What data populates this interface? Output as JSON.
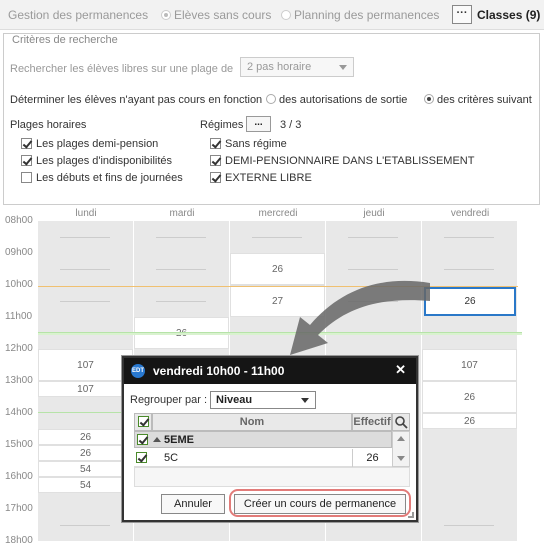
{
  "topbar": {
    "gestion": "Gestion des permanences",
    "eleves": "Elèves sans cours",
    "planning": "Planning des permanences",
    "more_label": "···",
    "classes": "Classes (9)"
  },
  "criteria": {
    "legend": "Critères de recherche",
    "search_label": "Rechercher les élèves libres sur une plage de",
    "plage_value": "2 pas horaire",
    "determine_label": "Déterminer les élèves n'ayant pas cours en fonction",
    "opt_autorisations": "des autorisations de sortie",
    "opt_criteres": "des critères suivant",
    "plages_label": "Plages horaires",
    "plages": [
      {
        "label": "Les plages demi-pension",
        "checked": true
      },
      {
        "label": "Les plages d'indisponibilités",
        "checked": true
      },
      {
        "label": "Les débuts et fins de journées",
        "checked": false
      }
    ],
    "regimes_label": "Régimes",
    "regimes_btn": "...",
    "regimes_count": "3 / 3",
    "regimes": [
      {
        "label": "Sans régime",
        "checked": true
      },
      {
        "label": "DEMI-PENSIONNAIRE DANS L'ETABLISSEMENT",
        "checked": true
      },
      {
        "label": "EXTERNE LIBRE",
        "checked": true
      }
    ]
  },
  "schedule": {
    "days": [
      "lundi",
      "mardi",
      "mercredi",
      "jeudi",
      "vendredi"
    ],
    "hours": [
      "08h00",
      "09h00",
      "10h00",
      "11h00",
      "12h00",
      "13h00",
      "14h00",
      "15h00",
      "16h00",
      "17h00",
      "18h00"
    ],
    "values": {
      "mer_09": "26",
      "mer_10": "27",
      "ven_10": "26",
      "mar_11": "26",
      "lun_12": "107",
      "ven_12": "107",
      "lun_13": "107",
      "ven_13": "26",
      "ven_14": "26",
      "lun_1430": "26",
      "lun_15": "26",
      "lun_1530": "54",
      "lun_16": "54"
    }
  },
  "popup": {
    "title": "vendredi 10h00 - 11h00",
    "badge": "EDT",
    "close": "✕",
    "group_label": "Regrouper par :",
    "group_value": "Niveau",
    "col_nom": "Nom",
    "col_effectif": "Effectif",
    "group_row": "5EME",
    "row_name": "5C",
    "row_effectif": "26",
    "btn_annuler": "Annuler",
    "btn_creer": "Créer un cours de permanence"
  },
  "colors": {
    "selected_border": "#2a78c8",
    "highlight": "#e27b79",
    "orange_line": "#f0c070",
    "green_line": "#b6e3a8"
  }
}
